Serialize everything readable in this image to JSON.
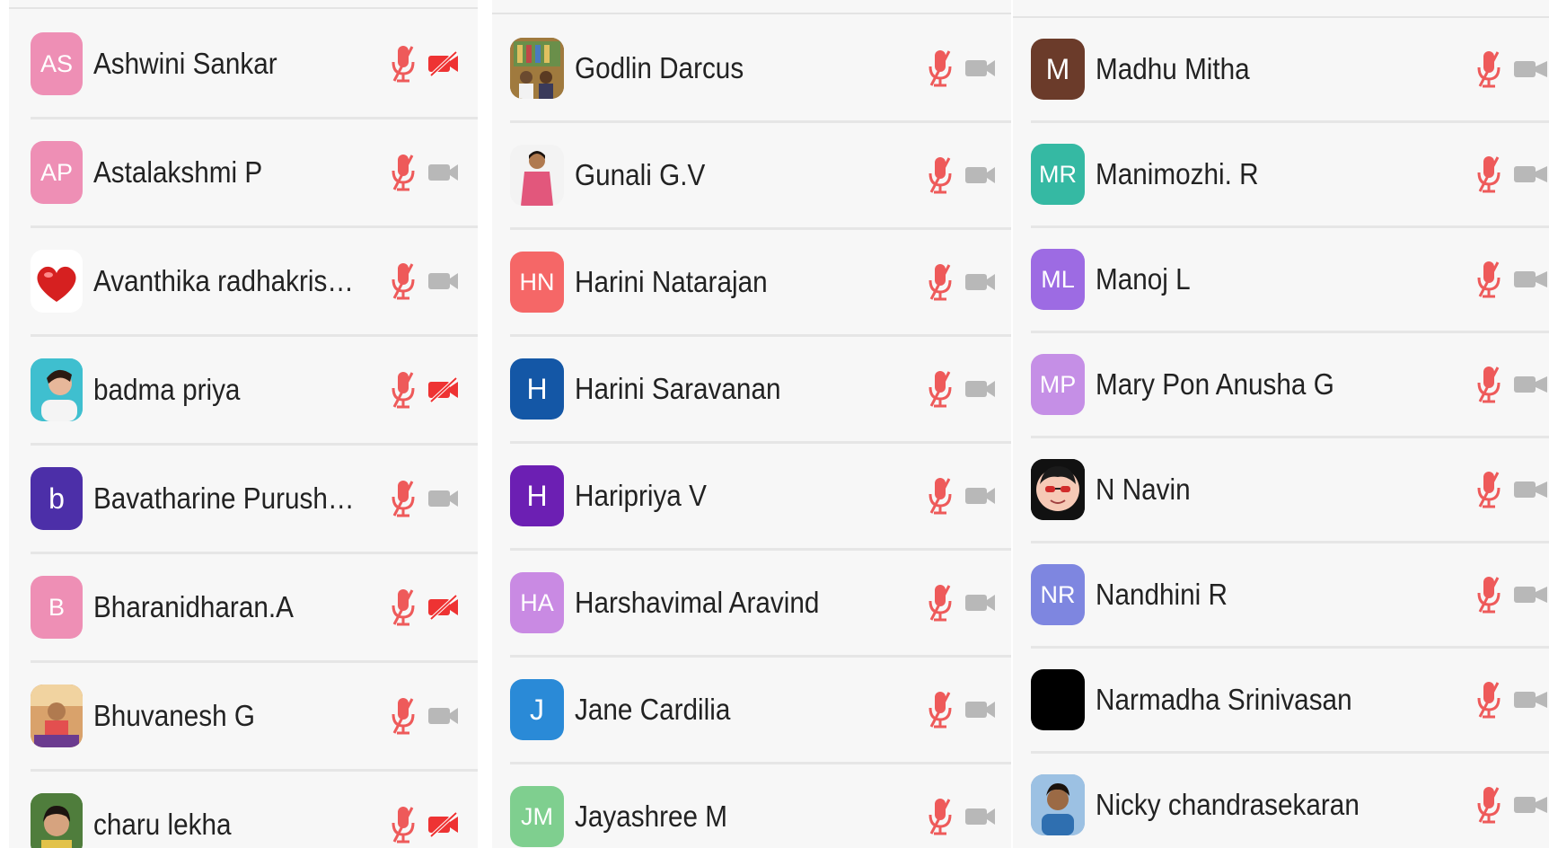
{
  "colors": {
    "mic_muted": "#ee5a5a",
    "video_off": "#ee3333",
    "video_on": "#b8b8b8"
  },
  "participants": [
    {
      "name": "Ashwini Sankar",
      "initials": "AS",
      "avatar_color": "#ee8fb5",
      "mic": "mic-muted-icon",
      "video": "video-off-icon"
    },
    {
      "name": "Astalakshmi P",
      "initials": "AP",
      "avatar_color": "#ee8fb5",
      "mic": "mic-muted-icon",
      "video": "video-icon"
    },
    {
      "name": "Avanthika radhakrishnan",
      "initials": "",
      "avatar_color": "",
      "photo": "heart-photo",
      "mic": "mic-muted-icon",
      "video": "video-icon"
    },
    {
      "name": "badma priya",
      "initials": "",
      "avatar_color": "",
      "photo": "portrait-photo",
      "mic": "mic-muted-icon",
      "video": "video-off-icon"
    },
    {
      "name": "Bavatharine Purushotha...",
      "initials": "b",
      "avatar_color": "#4c2fa8",
      "mic": "mic-muted-icon",
      "video": "video-icon"
    },
    {
      "name": "Bharanidharan.A",
      "initials": "B",
      "avatar_color": "#ee8fb5",
      "mic": "mic-muted-icon",
      "video": "video-off-icon"
    },
    {
      "name": "Bhuvanesh G",
      "initials": "",
      "avatar_color": "",
      "photo": "portrait-photo",
      "mic": "mic-muted-icon",
      "video": "video-icon"
    },
    {
      "name": "charu lekha",
      "initials": "",
      "avatar_color": "",
      "photo": "portrait-photo",
      "mic": "mic-muted-icon",
      "video": "video-off-icon"
    },
    {
      "name": "Godlin Darcus",
      "initials": "",
      "avatar_color": "",
      "photo": "group-photo",
      "mic": "mic-muted-icon",
      "video": "video-icon"
    },
    {
      "name": "Gunali G.V",
      "initials": "",
      "avatar_color": "",
      "photo": "portrait-photo",
      "mic": "mic-muted-icon",
      "video": "video-icon"
    },
    {
      "name": "Harini Natarajan",
      "initials": "HN",
      "avatar_color": "#f56767",
      "mic": "mic-muted-icon",
      "video": "video-icon"
    },
    {
      "name": "Harini Saravanan",
      "initials": "H",
      "avatar_color": "#1457a6",
      "mic": "mic-muted-icon",
      "video": "video-icon"
    },
    {
      "name": "Haripriya V",
      "initials": "H",
      "avatar_color": "#6c1fb3",
      "mic": "mic-muted-icon",
      "video": "video-icon"
    },
    {
      "name": "Harshavimal Aravind",
      "initials": "HA",
      "avatar_color": "#c98ae3",
      "mic": "mic-muted-icon",
      "video": "video-icon"
    },
    {
      "name": "Jane Cardilia",
      "initials": "J",
      "avatar_color": "#2a8ad7",
      "mic": "mic-muted-icon",
      "video": "video-icon"
    },
    {
      "name": "Jayashree M",
      "initials": "JM",
      "avatar_color": "#7fcf8f",
      "mic": "mic-muted-icon",
      "video": "video-icon"
    },
    {
      "name": "Madhu Mitha",
      "initials": "M",
      "avatar_color": "#6b3b2a",
      "mic": "mic-muted-icon",
      "video": "video-icon"
    },
    {
      "name": "Manimozhi. R",
      "initials": "MR",
      "avatar_color": "#35b9a3",
      "mic": "mic-muted-icon",
      "video": "video-icon"
    },
    {
      "name": "Manoj L",
      "initials": "ML",
      "avatar_color": "#9d6be3",
      "mic": "mic-muted-icon",
      "video": "video-icon"
    },
    {
      "name": "Mary Pon Anusha G",
      "initials": "MP",
      "avatar_color": "#c58fe6",
      "mic": "mic-muted-icon",
      "video": "video-icon"
    },
    {
      "name": "N Navin",
      "initials": "",
      "avatar_color": "",
      "photo": "cartoon-face-photo",
      "mic": "mic-muted-icon",
      "video": "video-icon"
    },
    {
      "name": "Nandhini R",
      "initials": "NR",
      "avatar_color": "#7e86e0",
      "mic": "mic-muted-icon",
      "video": "video-icon"
    },
    {
      "name": "Narmadha Srinivasan",
      "initials": "",
      "avatar_color": "#000000",
      "mic": "mic-muted-icon",
      "video": "video-icon"
    },
    {
      "name": "Nicky chandrasekaran",
      "initials": "",
      "avatar_color": "",
      "photo": "portrait-photo",
      "mic": "mic-muted-icon",
      "video": "video-icon"
    }
  ]
}
